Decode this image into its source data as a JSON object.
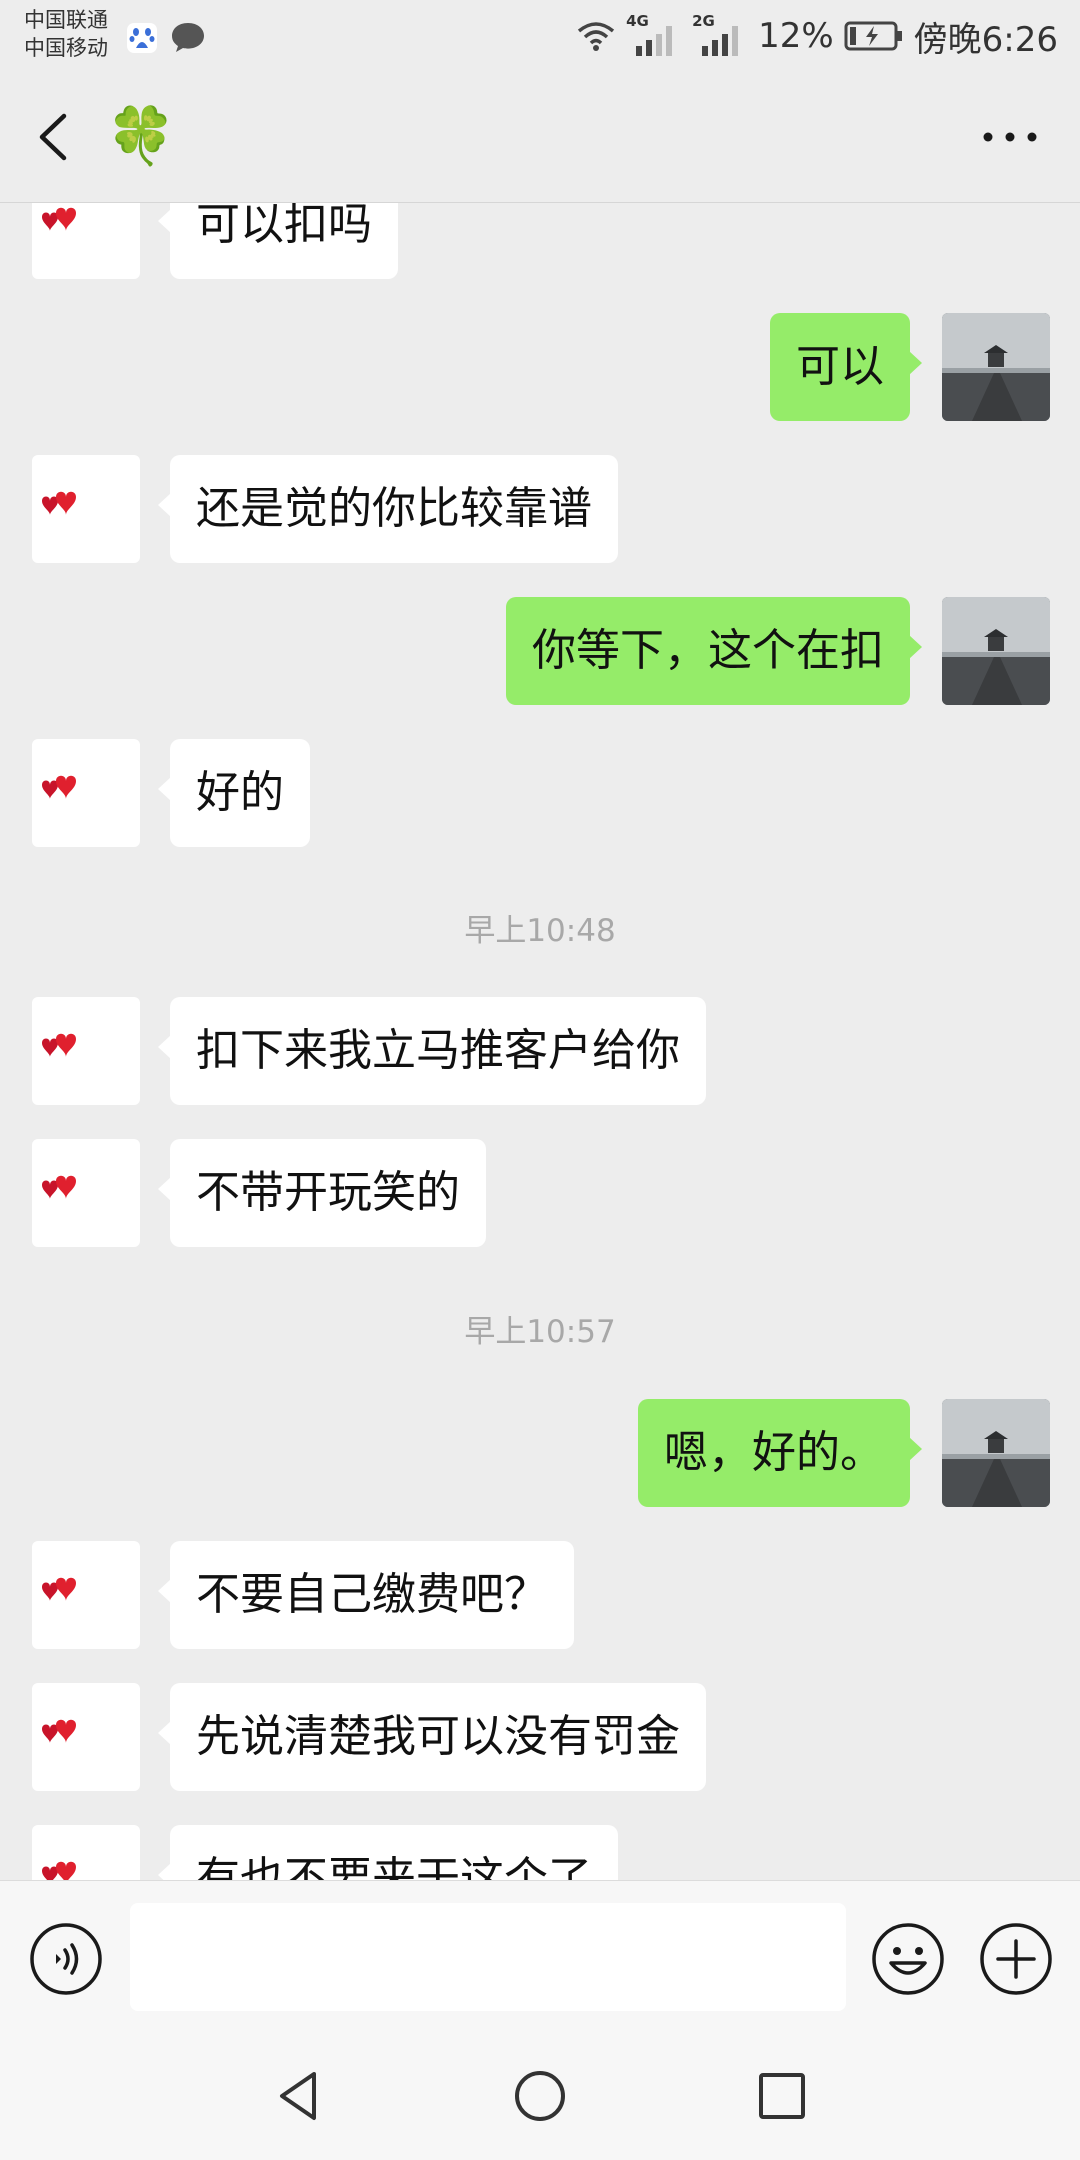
{
  "status_bar": {
    "carrier_1": "中国联通",
    "carrier_2": "中国移动",
    "network_1": "4G",
    "network_2": "2G",
    "battery": "12%",
    "time": "傍晚6:26"
  },
  "header": {
    "title": "🍀"
  },
  "messages": [
    {
      "side": "in",
      "text": "可以扣吗"
    },
    {
      "side": "out",
      "text": "可以"
    },
    {
      "side": "in",
      "text": "还是觉的你比较靠谱"
    },
    {
      "side": "out",
      "text": "你等下，这个在扣"
    },
    {
      "side": "in",
      "text": "好的"
    },
    {
      "time": "早上10:48"
    },
    {
      "side": "in",
      "text": "扣下来我立马推客户给你"
    },
    {
      "side": "in",
      "text": "不带开玩笑的"
    },
    {
      "time": "早上10:57"
    },
    {
      "side": "out",
      "text": "嗯，好的。"
    },
    {
      "side": "in",
      "text": "不要自己缴费吧？"
    },
    {
      "side": "in",
      "text": "先说清楚我可以没有罚金"
    },
    {
      "side": "in",
      "text": "有也不要来干这个了"
    }
  ],
  "input": {
    "value": "",
    "placeholder": ""
  },
  "icons": {
    "back": "chevron-left-icon",
    "more": "more-dots-icon",
    "voice": "voice-icon",
    "emoji": "emoji-icon",
    "plus": "plus-icon"
  },
  "colors": {
    "outgoing_bubble": "#95ec69",
    "incoming_bubble": "#ffffff",
    "background": "#ededed"
  }
}
